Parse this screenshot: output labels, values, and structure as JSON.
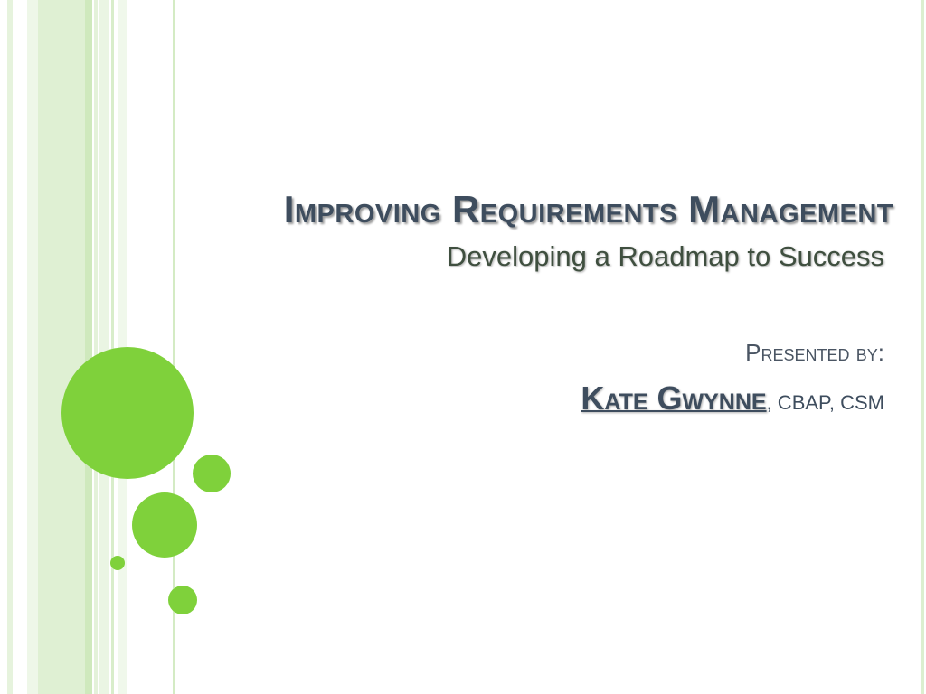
{
  "slide": {
    "title": "Improving Requirements Management",
    "subtitle": "Developing a Roadmap to Success",
    "presented_by": "Presented by:",
    "presenter_name": "Kate Gwynne",
    "presenter_credentials": ", CBAP, CSM"
  },
  "colors": {
    "accent_green": "#7fd13b",
    "stripe_light": "#e3f2d8",
    "title_text": "#3e4d5e"
  }
}
